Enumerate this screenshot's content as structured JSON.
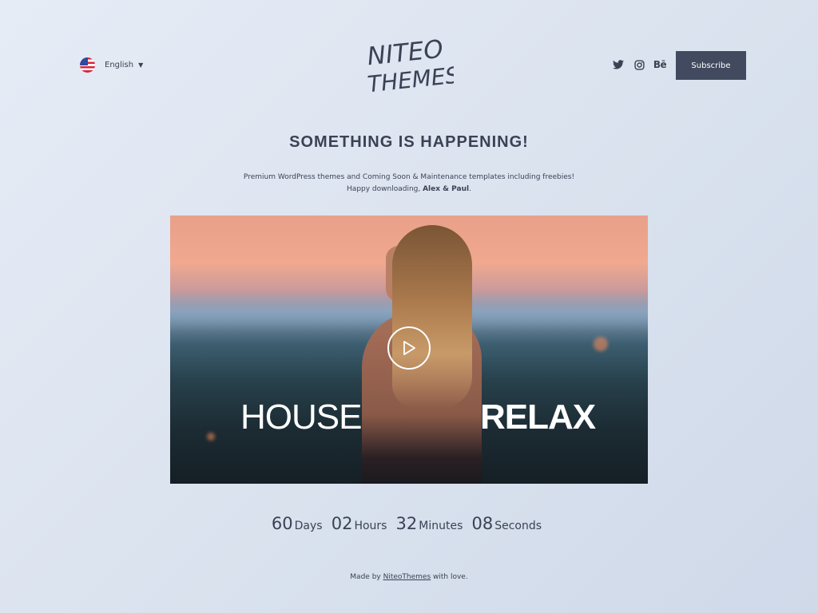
{
  "header": {
    "language": {
      "label": "English",
      "flag": "us-flag-icon"
    },
    "logo": {
      "line1": "NITEO",
      "line2": "THEMES"
    },
    "social": [
      {
        "name": "twitter-icon"
      },
      {
        "name": "instagram-icon"
      },
      {
        "name": "behance-icon",
        "glyph": "Bē"
      }
    ],
    "subscribe_label": "Subscribe"
  },
  "main": {
    "title": "SOMETHING IS HAPPENING!",
    "subtitle_line1": "Premium WordPress themes and Coming Soon & Maintenance templates including freebies!",
    "subtitle_line2_prefix": "Happy downloading, ",
    "subtitle_line2_bold": "Alex & Paul",
    "subtitle_line2_suffix": "."
  },
  "video": {
    "left_text": "HOUSE",
    "right_text": "RELAX"
  },
  "countdown": {
    "days": "60",
    "days_label": "Days",
    "hours": "02",
    "hours_label": "Hours",
    "minutes": "32",
    "minutes_label": "Minutes",
    "seconds": "08",
    "seconds_label": "Seconds"
  },
  "footer": {
    "prefix": "Made by ",
    "link": "NiteoThemes",
    "suffix": " with love."
  },
  "colors": {
    "text": "#3b4255",
    "button_bg": "#424a60",
    "button_text": "#ffffff"
  }
}
